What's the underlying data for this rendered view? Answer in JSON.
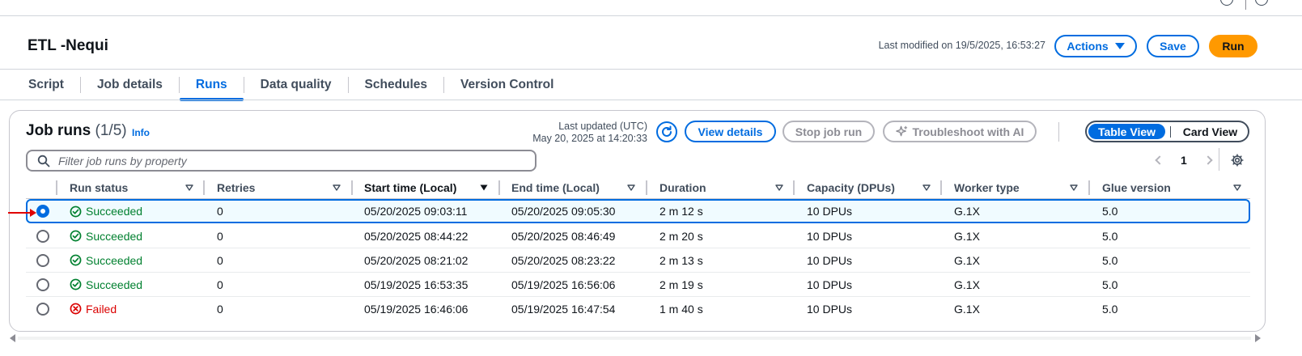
{
  "header": {
    "title": "ETL -Nequi",
    "last_modified": "Last modified on 19/5/2025, 16:53:27",
    "actions_label": "Actions",
    "save_label": "Save",
    "run_label": "Run"
  },
  "tabs": [
    {
      "label": "Script",
      "active": false
    },
    {
      "label": "Job details",
      "active": false
    },
    {
      "label": "Runs",
      "active": true
    },
    {
      "label": "Data quality",
      "active": false
    },
    {
      "label": "Schedules",
      "active": false
    },
    {
      "label": "Version Control",
      "active": false
    }
  ],
  "runs_panel": {
    "title": "Job runs",
    "count": "(1/5)",
    "info_label": "Info",
    "last_updated_label": "Last updated (UTC)",
    "last_updated_value": "May 20, 2025 at 14:20:33",
    "view_details_label": "View details",
    "stop_job_run_label": "Stop job run",
    "troubleshoot_label": "Troubleshoot with AI",
    "table_view_label": "Table View",
    "card_view_label": "Card View",
    "filter_placeholder": "Filter job runs by property",
    "page_number": "1"
  },
  "table": {
    "columns": [
      "Run status",
      "Retries",
      "Start time (Local)",
      "End time (Local)",
      "Duration",
      "Capacity (DPUs)",
      "Worker type",
      "Glue version"
    ],
    "rows": [
      {
        "selected": true,
        "status": "Succeeded",
        "retries": "0",
        "start": "05/20/2025 09:03:11",
        "end": "05/20/2025 09:05:30",
        "duration": "2 m 12 s",
        "capacity": "10 DPUs",
        "worker": "G.1X",
        "glue": "5.0"
      },
      {
        "selected": false,
        "status": "Succeeded",
        "retries": "0",
        "start": "05/20/2025 08:44:22",
        "end": "05/20/2025 08:46:49",
        "duration": "2 m 20 s",
        "capacity": "10 DPUs",
        "worker": "G.1X",
        "glue": "5.0"
      },
      {
        "selected": false,
        "status": "Succeeded",
        "retries": "0",
        "start": "05/20/2025 08:21:02",
        "end": "05/20/2025 08:23:22",
        "duration": "2 m 13 s",
        "capacity": "10 DPUs",
        "worker": "G.1X",
        "glue": "5.0"
      },
      {
        "selected": false,
        "status": "Succeeded",
        "retries": "0",
        "start": "05/19/2025 16:53:35",
        "end": "05/19/2025 16:56:06",
        "duration": "2 m 19 s",
        "capacity": "10 DPUs",
        "worker": "G.1X",
        "glue": "5.0"
      },
      {
        "selected": false,
        "status": "Failed",
        "retries": "0",
        "start": "05/19/2025 16:46:06",
        "end": "05/19/2025 16:47:54",
        "duration": "1 m 40 s",
        "capacity": "10 DPUs",
        "worker": "G.1X",
        "glue": "5.0"
      }
    ]
  },
  "colors": {
    "accent": "#006ce0",
    "run_button": "#ff9900",
    "success": "#00802f",
    "failed": "#db0000",
    "annotation_arrow": "#e00000"
  },
  "icons": [
    "info-icon",
    "settings-icon",
    "refresh-icon",
    "sparkle-icon",
    "search-icon",
    "chevron-left-icon",
    "chevron-right-icon",
    "gear-icon",
    "sort-caret-icon",
    "check-circle-icon",
    "x-circle-icon"
  ]
}
